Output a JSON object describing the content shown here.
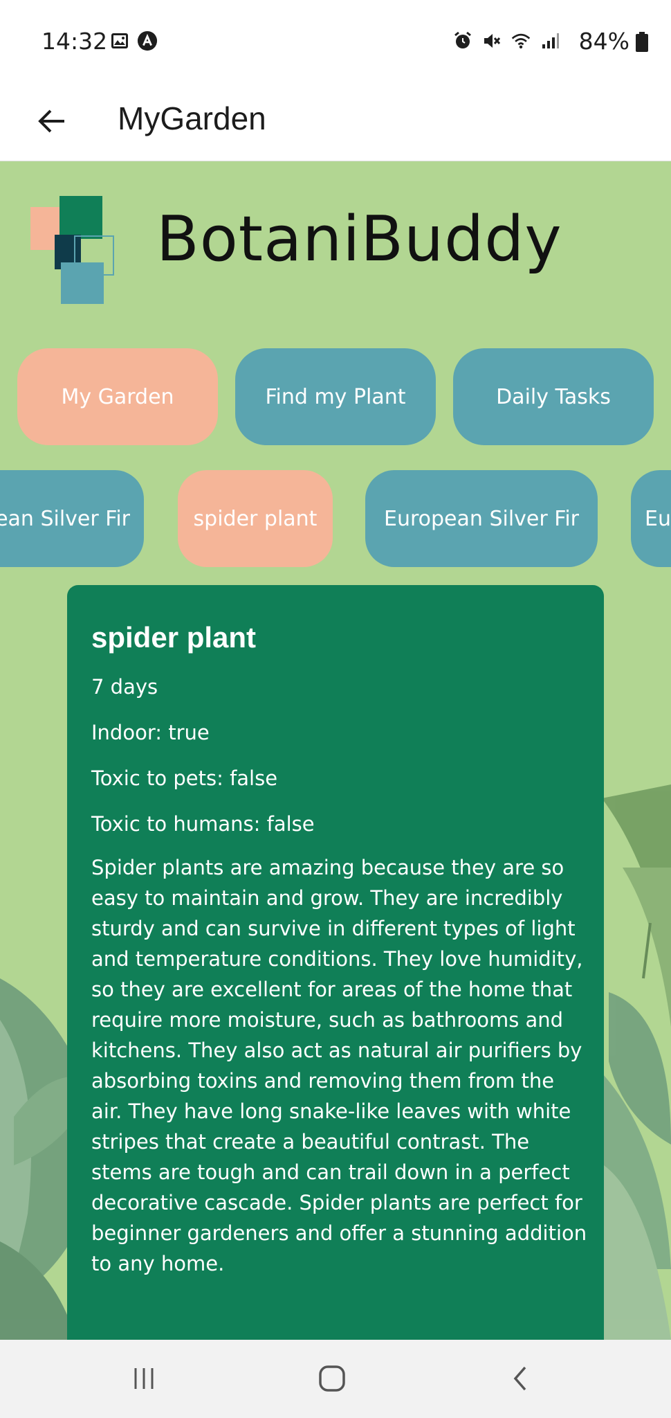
{
  "status_bar": {
    "time": "14:32",
    "battery": "84%",
    "left_icons": [
      "image-icon",
      "a-notification-icon"
    ],
    "right_icons": [
      "alarm-icon",
      "mute-icon",
      "wifi-icon",
      "signal-icon",
      "battery-icon"
    ]
  },
  "app_bar": {
    "title": "MyGarden",
    "back_icon": "arrow-left-icon"
  },
  "brand": {
    "name": "BotaniBuddy"
  },
  "nav_buttons": [
    {
      "label": "My Garden",
      "selected": true
    },
    {
      "label": "Find my Plant",
      "selected": false
    },
    {
      "label": "Daily Tasks",
      "selected": false
    }
  ],
  "plant_tabs": [
    {
      "label": "European Silver Fir",
      "selected": false
    },
    {
      "label": "spider plant",
      "selected": true
    },
    {
      "label": "European Silver Fir",
      "selected": false
    },
    {
      "label": "Eu",
      "selected": false
    }
  ],
  "plant_card": {
    "name": "spider plant",
    "watering": "7 days",
    "indoor": "Indoor: true",
    "toxic_pets": "Toxic to pets: false",
    "toxic_humans": "Toxic to humans: false",
    "description": "Spider plants are amazing because they are so easy to maintain and grow. They are incredibly sturdy and can survive in different types of light and temperature conditions. They love humidity, so they are excellent for areas of the home that require more moisture, such as bathrooms and kitchens. They also act as natural air purifiers by absorbing toxins and removing them from the air. They have long snake-like leaves with white stripes that create a beautiful contrast. The stems are tough and can trail down in a perfect decorative cascade. Spider plants are perfect for beginner gardeners and offer a stunning addition to any home."
  },
  "colors": {
    "background": "#b2d692",
    "selected": "#f5b598",
    "unselected": "#5ba4b0",
    "card": "#107f57"
  }
}
